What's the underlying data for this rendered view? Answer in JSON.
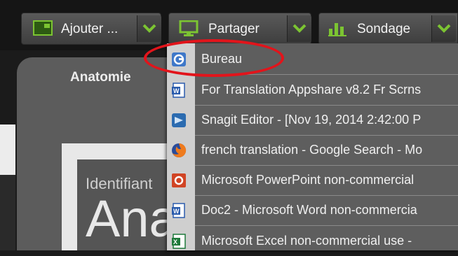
{
  "toolbar": {
    "buttons": [
      {
        "label": "Ajouter ...",
        "icon": "add-screen-icon"
      },
      {
        "label": "Partager",
        "icon": "monitor-icon"
      },
      {
        "label": "Sondage",
        "icon": "bar-chart-icon"
      }
    ]
  },
  "panel": {
    "tab_title": "Anatomie",
    "id_label": "Identifiant",
    "big_text": "Ana"
  },
  "dropdown": {
    "items": [
      {
        "label": "Bureau",
        "icon": "desktop-share-icon"
      },
      {
        "label": "For Translation Appshare v8.2 Fr Scrns",
        "icon": "word-doc-icon"
      },
      {
        "label": "Snagit Editor - [Nov 19, 2014 2:42:00 P",
        "icon": "snagit-icon"
      },
      {
        "label": "french translation - Google Search - Mo",
        "icon": "firefox-icon"
      },
      {
        "label": "Microsoft PowerPoint non-commercial",
        "icon": "powerpoint-icon"
      },
      {
        "label": "Doc2 - Microsoft Word non-commercia",
        "icon": "word-doc-icon"
      },
      {
        "label": "Microsoft Excel non-commercial use - ",
        "icon": "excel-icon"
      }
    ]
  },
  "colors": {
    "accent_green": "#6fb52c",
    "highlight_red": "#e2141b",
    "menu_bg": "#5e5e5e"
  }
}
